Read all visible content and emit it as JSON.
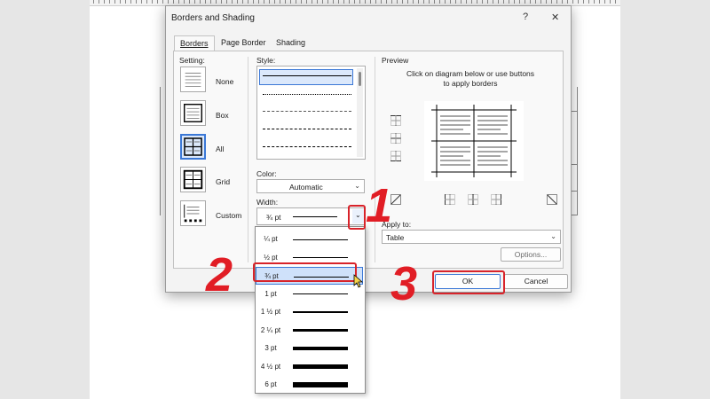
{
  "dialog": {
    "title": "Borders and Shading",
    "help_glyph": "?",
    "close_glyph": "✕",
    "tabs": [
      {
        "label": "Borders",
        "active": true
      },
      {
        "label": "Page Border",
        "active": false
      },
      {
        "label": "Shading",
        "active": false
      }
    ],
    "setting": {
      "label": "Setting:",
      "options": [
        {
          "label": "None",
          "icon": "setting-none-icon",
          "selected": false
        },
        {
          "label": "Box",
          "icon": "setting-box-icon",
          "selected": false
        },
        {
          "label": "All",
          "icon": "setting-all-icon",
          "selected": true
        },
        {
          "label": "Grid",
          "icon": "setting-grid-icon",
          "selected": false
        },
        {
          "label": "Custom",
          "icon": "setting-custom-icon",
          "selected": false
        }
      ]
    },
    "style": {
      "label": "Style:"
    },
    "color": {
      "label": "Color:",
      "value": "Automatic"
    },
    "width": {
      "label": "Width:",
      "value": "¾ pt"
    },
    "width_options": [
      "¼ pt",
      "½ pt",
      "¾ pt",
      "1 pt",
      "1 ½ pt",
      "2 ¼ pt",
      "3 pt",
      "4 ½ pt",
      "6 pt"
    ],
    "width_selected": "¾ pt",
    "preview": {
      "label": "Preview",
      "instruction_line1": "Click on diagram below or use buttons",
      "instruction_line2": "to apply borders"
    },
    "apply_to": {
      "label": "Apply to:",
      "value": "Table"
    },
    "options_label": "Options...",
    "ok_label": "OK",
    "cancel_label": "Cancel"
  },
  "annotations": {
    "step1": "1",
    "step2": "2",
    "step3": "3",
    "color": "#e11d25"
  },
  "colors": {
    "accent": "#3b78d6",
    "selection_fill": "#cfe1fa",
    "annotation_red": "#e11d25"
  }
}
